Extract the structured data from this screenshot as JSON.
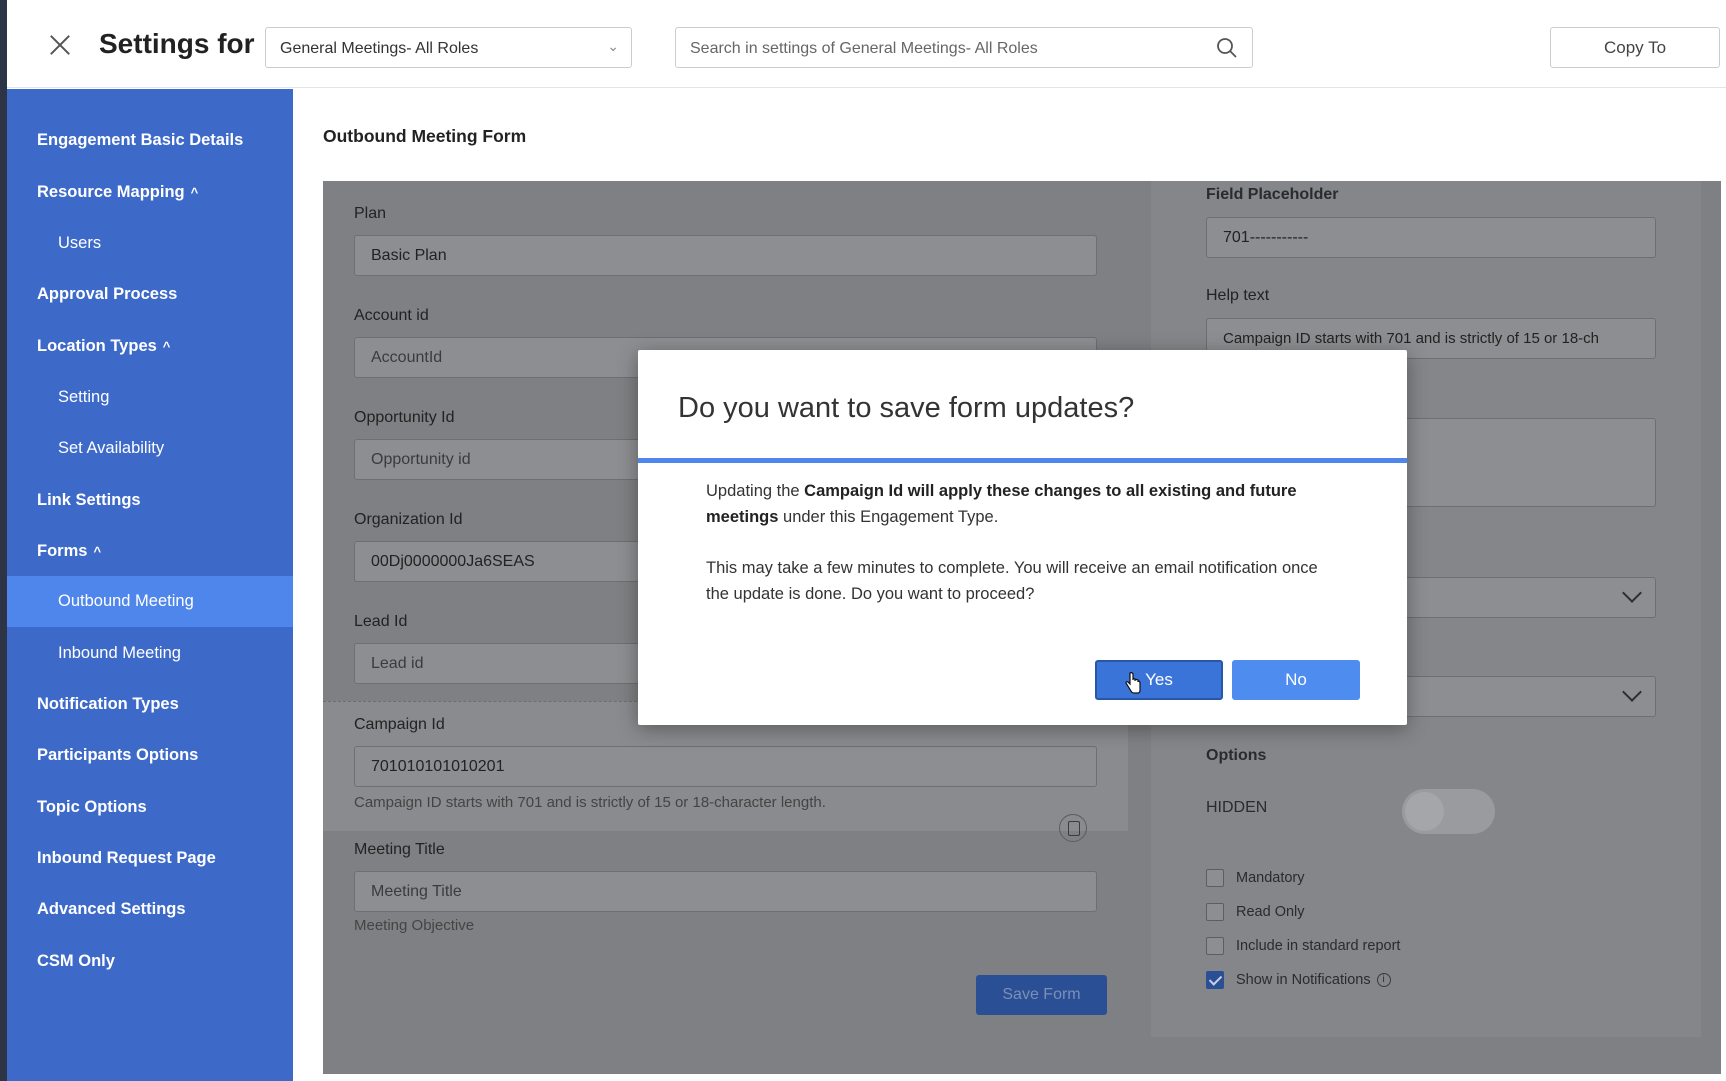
{
  "header": {
    "title": "Settings for",
    "role_select": "General Meetings- All Roles",
    "search_placeholder": "Search in settings of General Meetings- All Roles",
    "copy_label": "Copy To"
  },
  "sidebar": {
    "items": [
      {
        "label": "Engagement Basic Details"
      },
      {
        "label": "Resource Mapping",
        "caret": "^"
      },
      {
        "label": "Users"
      },
      {
        "label": "Approval Process"
      },
      {
        "label": "Location Types",
        "caret": "^"
      },
      {
        "label": "Setting"
      },
      {
        "label": "Set Availability"
      },
      {
        "label": "Link Settings"
      },
      {
        "label": "Forms",
        "caret": "^"
      },
      {
        "label": "Outbound Meeting"
      },
      {
        "label": "Inbound Meeting"
      },
      {
        "label": "Notification Types"
      },
      {
        "label": "Participants Options"
      },
      {
        "label": "Topic Options"
      },
      {
        "label": "Inbound Request Page"
      },
      {
        "label": "Advanced Settings"
      },
      {
        "label": "CSM Only"
      }
    ],
    "active_item": "Outbound Meeting"
  },
  "main": {
    "title": "Outbound Meeting Form",
    "fields": {
      "plan": {
        "label": "Plan",
        "value": "Basic Plan"
      },
      "account_id": {
        "label": "Account id",
        "placeholder": "AccountId"
      },
      "opportunity_id": {
        "label": "Opportunity Id",
        "placeholder": "Opportunity id"
      },
      "organization_id": {
        "label": "Organization Id",
        "value": "00Dj0000000Ja6SEAS"
      },
      "lead_id": {
        "label": "Lead Id",
        "placeholder": "Lead id"
      },
      "campaign_id": {
        "label": "Campaign Id",
        "value": "701010101010201",
        "hint": "Campaign ID starts with 701 and is strictly of 15 or 18-character length."
      },
      "meeting_title": {
        "label": "Meeting Title",
        "placeholder": "Meeting Title",
        "hint": "Meeting Objective"
      }
    },
    "save_form_label": "Save Form",
    "right_panel": {
      "field_placeholder_label": "Field Placeholder",
      "field_placeholder_value": "701-----------",
      "help_text_label": "Help text",
      "help_text_value": "Campaign ID starts with 701 and is strictly of 15 or 18-ch",
      "options_label": "Options",
      "hidden_label": "HIDDEN",
      "checkboxes": [
        {
          "label": "Mandatory",
          "checked": false
        },
        {
          "label": "Read Only",
          "checked": false
        },
        {
          "label": "Include in standard report",
          "checked": false
        },
        {
          "label": "Show in Notifications",
          "checked": true
        }
      ]
    }
  },
  "modal": {
    "title": "Do you want to save form updates?",
    "p1_prefix": "Updating the ",
    "p1_bold": "Campaign Id will apply these changes to all existing and future meetings",
    "p1_suffix": " under this Engagement Type.",
    "p2": "This may take a few minutes to complete. You will receive an email notification once the update is done. Do you want to proceed?",
    "yes_label": "Yes",
    "no_label": "No"
  },
  "colors": {
    "sidebar_bg": "#3d6ac9",
    "sidebar_active": "#4e86ec",
    "modal_accent": "#4e86ec",
    "button_blue": "#3a74d9"
  }
}
